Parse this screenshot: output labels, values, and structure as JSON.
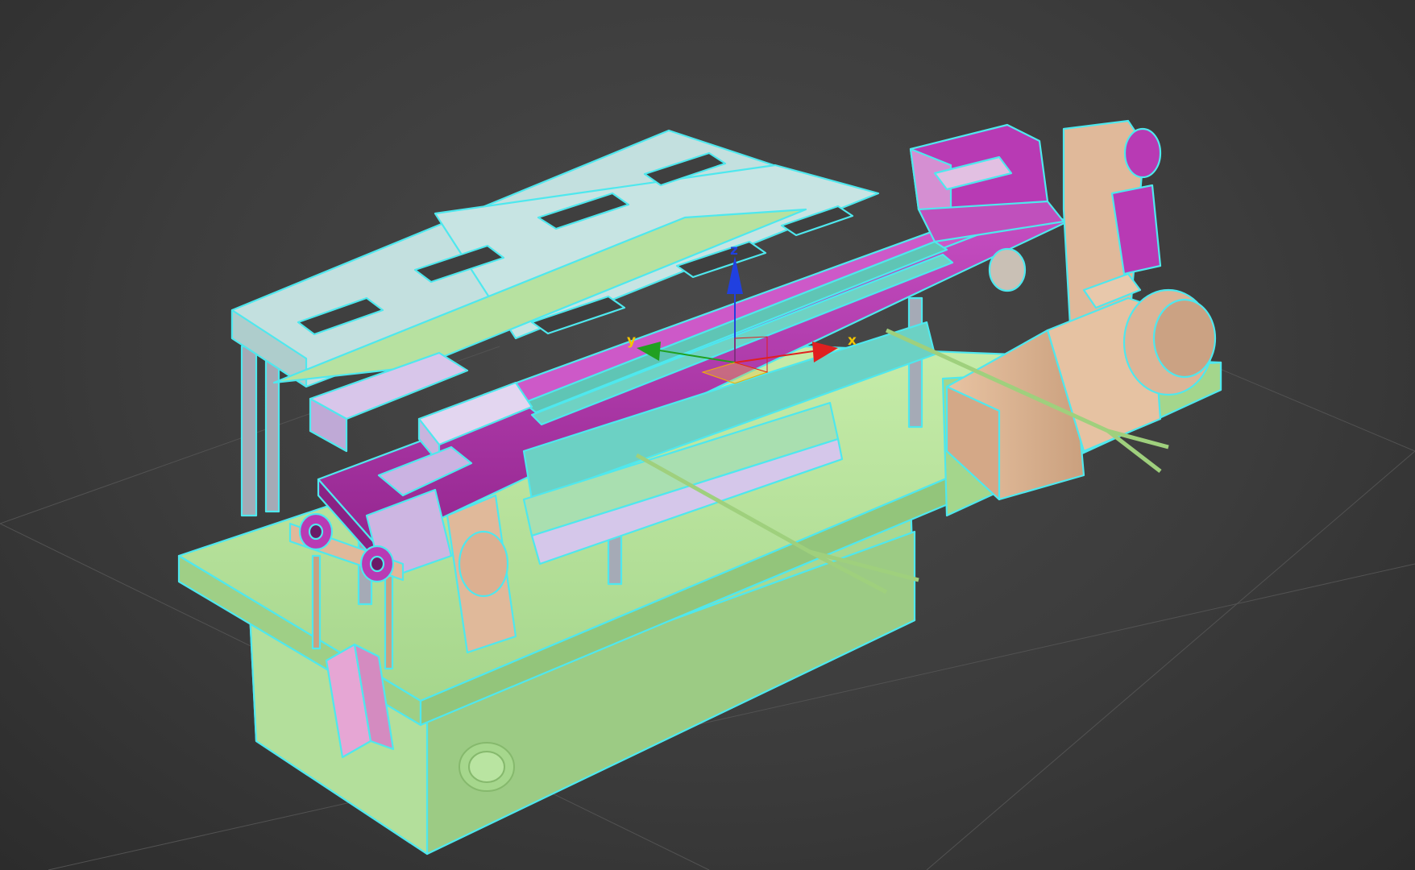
{
  "viewport": {
    "gizmo": {
      "x_label": "x",
      "y_label": "y",
      "z_label": "z"
    }
  },
  "colors": {
    "background": "#3c3c3c",
    "grid": "#555555",
    "selection_outline": "#4ee8ee",
    "base_plate": "#b6e39a",
    "top_frame": "#c3e0df",
    "magenta_part": "#b83ab4",
    "motor": "#e0b99a",
    "lilac_part": "#cdb6e2",
    "pink_cylinder": "#e6a6d4",
    "teal_part": "#6cd1c4",
    "steel_rod": "#a5aab6",
    "axis_x": "#e02020",
    "axis_y": "#20a020",
    "axis_z": "#2040e0",
    "axis_label": "#f2c500"
  },
  "icons": {
    "transform_gizmo": "move-gizmo-icon"
  }
}
